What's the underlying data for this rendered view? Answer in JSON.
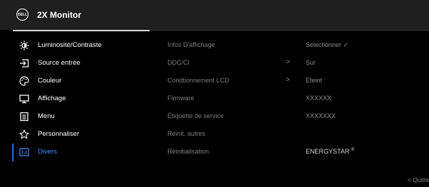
{
  "header": {
    "logo_text": "DELL",
    "title": "2X Monitor"
  },
  "menu": [
    {
      "label": "Luminosité/Contraste",
      "icon": "brightness-icon"
    },
    {
      "label": "Source entrée",
      "icon": "input-source-icon"
    },
    {
      "label": "Couleur",
      "icon": "palette-icon"
    },
    {
      "label": "Affichage",
      "icon": "display-icon"
    },
    {
      "label": "Menu",
      "icon": "menu-list-icon"
    },
    {
      "label": "Personnaliser",
      "icon": "star-icon"
    },
    {
      "label": "Divers",
      "icon": "others-icon",
      "active": true
    }
  ],
  "rows": [
    {
      "label": "Infos D'affichage",
      "chevron": "",
      "value": "Sélectionner ✓"
    },
    {
      "label": "DDC/CI",
      "chevron": ">",
      "value": "Sur"
    },
    {
      "label": "Condtionnement LCD",
      "chevron": ">",
      "value": "Eteint"
    },
    {
      "label": "Firmware",
      "chevron": "",
      "value": "XXXXXX"
    },
    {
      "label": "Étiquette de service",
      "chevron": "",
      "value": "XXXXXXX"
    },
    {
      "label": "Réinit. autres",
      "chevron": "",
      "value": ""
    },
    {
      "label": "Réinitialisation",
      "chevron": "",
      "value": "ENERGYSTAR",
      "value_sup": "®"
    }
  ],
  "footer": {
    "quit_label": "< Quitte"
  },
  "colors": {
    "accent": "#1f6fff",
    "active_text": "#3d8bff",
    "header_bg": "#1f1f1f"
  }
}
